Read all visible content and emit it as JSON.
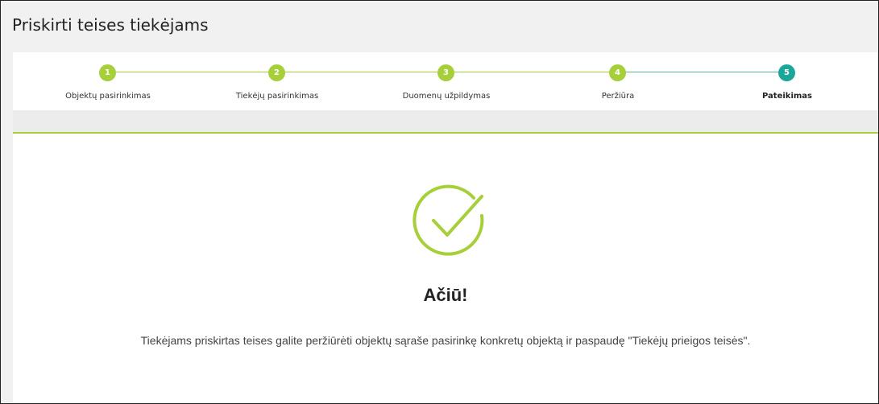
{
  "page": {
    "title": "Priskirti teises tiekėjams"
  },
  "stepper": {
    "steps": [
      {
        "number": "1",
        "label": "Objektų pasirinkimas"
      },
      {
        "number": "2",
        "label": "Tiekėjų pasirinkimas"
      },
      {
        "number": "3",
        "label": "Duomenų užpildymas"
      },
      {
        "number": "4",
        "label": "Peržiūra"
      },
      {
        "number": "5",
        "label": "Pateikimas"
      }
    ],
    "active_index": 4,
    "colors": {
      "done": "#a6cf3a",
      "active": "#1aa79a"
    }
  },
  "success": {
    "icon": "check-circle-icon",
    "heading": "Ačiū!",
    "message": "Tiekėjams priskirtas teises galite peržiūrėti objektų sąraše pasirinkę konkretų objektą ir paspaudę \"Tiekėjų prieigos teisės\"."
  }
}
